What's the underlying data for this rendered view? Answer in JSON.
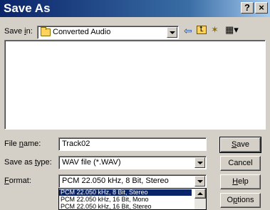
{
  "window": {
    "title": "Save As",
    "help_glyph": "?",
    "close_glyph": "×"
  },
  "save_in": {
    "label_pre": "Save ",
    "label_key": "i",
    "label_post": "n:",
    "value": "Converted Audio"
  },
  "toolbar": {
    "back_glyph": "⇦",
    "up_glyph": "⮤",
    "new_folder_glyph": "✶",
    "view_glyph": "▦▾"
  },
  "file_name": {
    "label_pre": "File ",
    "label_key": "n",
    "label_post": "ame:",
    "value": "Track02"
  },
  "save_as_type": {
    "label_pre": "Save as ",
    "label_key": "t",
    "label_post": "ype:",
    "value": "WAV file (*.WAV)"
  },
  "format": {
    "label_pre": "",
    "label_key": "F",
    "label_post": "ormat:",
    "value": "PCM 22.050 kHz, 8 Bit, Stereo",
    "options": [
      "PCM 22.050 kHz, 8 Bit, Stereo",
      "PCM 22.050 kHz, 16 Bit, Mono",
      "PCM 22.050 kHz, 16 Bit, Stereo"
    ],
    "selected_index": 0
  },
  "buttons": {
    "save": {
      "pre": "",
      "key": "S",
      "post": "ave"
    },
    "cancel": {
      "label": "Cancel"
    },
    "help": {
      "pre": "",
      "key": "H",
      "post": "elp"
    },
    "options": {
      "pre": "O",
      "key": "p",
      "post": "tions"
    }
  }
}
